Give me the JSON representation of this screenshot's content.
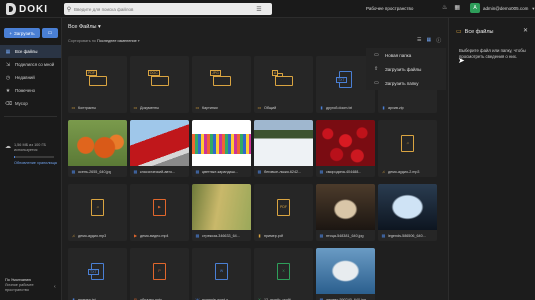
{
  "app": {
    "name": "DOKI"
  },
  "search": {
    "placeholder": "Введите для поиска файлов"
  },
  "header": {
    "workspace": "Рабочее пространство",
    "user_email": "admin@demo005.com",
    "avatar_letter": "A"
  },
  "sidebar": {
    "upload_label": "Загрузить",
    "items": [
      {
        "label": "Все файлы",
        "icon": "folder-icon",
        "active": true
      },
      {
        "label": "Поделился со мной",
        "icon": "share-icon"
      },
      {
        "label": "Недавний",
        "icon": "clock-icon"
      },
      {
        "label": "Помечено",
        "icon": "star-icon"
      },
      {
        "label": "Мусор",
        "icon": "trash-icon"
      }
    ],
    "storage_line1": "1,56 МБ из 100 ГБ",
    "storage_line2": "используется",
    "storage_fraction": 0.03,
    "upgrade_link": "Обновление хранилища",
    "footer_line1": "По Умолчанию",
    "footer_line2": "Личное рабочее",
    "footer_line3": "пространство"
  },
  "main": {
    "breadcrumb": "Все Файлы",
    "sort_prefix": "Сортировать по",
    "sort_value": "Последнее изменение"
  },
  "context_menu": [
    {
      "label": "Новая папка",
      "icon": "new-folder-icon"
    },
    {
      "label": "Загрузить файлы",
      "icon": "upload-file-icon"
    },
    {
      "label": "Загрузить папку",
      "icon": "upload-folder-icon"
    }
  ],
  "panel": {
    "title": "Все файлы",
    "text": "Выберите файл или папку, чтобы просмотреть сведения о них."
  },
  "files": [
    {
      "name": "Контракты",
      "kind": "folder",
      "badge": "PDF"
    },
    {
      "name": "Документы",
      "kind": "folder",
      "badge": "DOC"
    },
    {
      "name": "Картинки",
      "kind": "folder",
      "badge": "JPG"
    },
    {
      "name": "Общий",
      "kind": "folder",
      "badge": "A"
    },
    {
      "name": "другой.docm.txt",
      "kind": "txt",
      "badge": "TXT"
    },
    {
      "name": "архив.zip",
      "kind": "blank"
    },
    {
      "name": "осень-2655_640.jpg",
      "kind": "photo",
      "photo": "pump"
    },
    {
      "name": "классический-авто...",
      "kind": "photo",
      "photo": "car"
    },
    {
      "name": "цветные-карандаш...",
      "kind": "photo",
      "photo": "pencil"
    },
    {
      "name": "беговые-лыжи-6242...",
      "kind": "photo",
      "photo": "ski"
    },
    {
      "name": "смородина-404488...",
      "kind": "photo",
      "photo": "berry"
    },
    {
      "name": "демо-аудио-2.mp3",
      "kind": "audio"
    },
    {
      "name": "демо-аудио.mp3",
      "kind": "audio"
    },
    {
      "name": "демо-видео.mp4",
      "kind": "video"
    },
    {
      "name": "стрекоза-346633_64...",
      "kind": "photo",
      "photo": "drag"
    },
    {
      "name": "пример.pdf",
      "kind": "pdf"
    },
    {
      "name": "птица-548381_640.jpg",
      "kind": "photo",
      "photo": "bird"
    },
    {
      "name": "legends-586506_640...",
      "kind": "photo",
      "photo": "ice"
    },
    {
      "name": "пример.txt",
      "kind": "txt",
      "badge": "TXT"
    },
    {
      "name": "образец.pptx",
      "kind": "ppt"
    },
    {
      "name": "example-word-s...",
      "kind": "word"
    },
    {
      "name": "12_month_profit_...",
      "kind": "excel"
    },
    {
      "name": "дерево-590240_640.jpg",
      "kind": "photo",
      "photo": "duck"
    }
  ]
}
